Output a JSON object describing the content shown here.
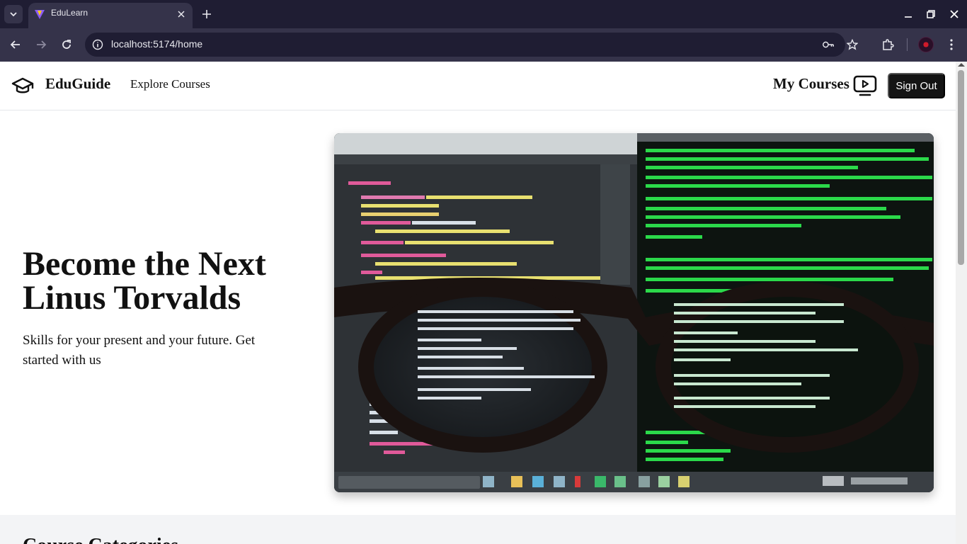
{
  "browser": {
    "tab_title": "EduLearn",
    "url": "localhost:5174/home"
  },
  "nav": {
    "brand": "EduGuide",
    "explore": "Explore Courses",
    "my_courses": "My Courses",
    "sign_out": "Sign Out"
  },
  "hero": {
    "title": "Become the Next Linus Torvalds",
    "subtitle": "Skills for your present and your future. Get started with us"
  },
  "sections": {
    "categories_title": "Course Categories"
  },
  "colors": {
    "button_bg": "#141414",
    "browser_frame": "#1f1d33",
    "terminal_green": "#2bd94a"
  },
  "icons": [
    "graduation-cap-icon",
    "play-video-icon",
    "key-icon",
    "star-icon",
    "extensions-icon",
    "menu-icon"
  ]
}
